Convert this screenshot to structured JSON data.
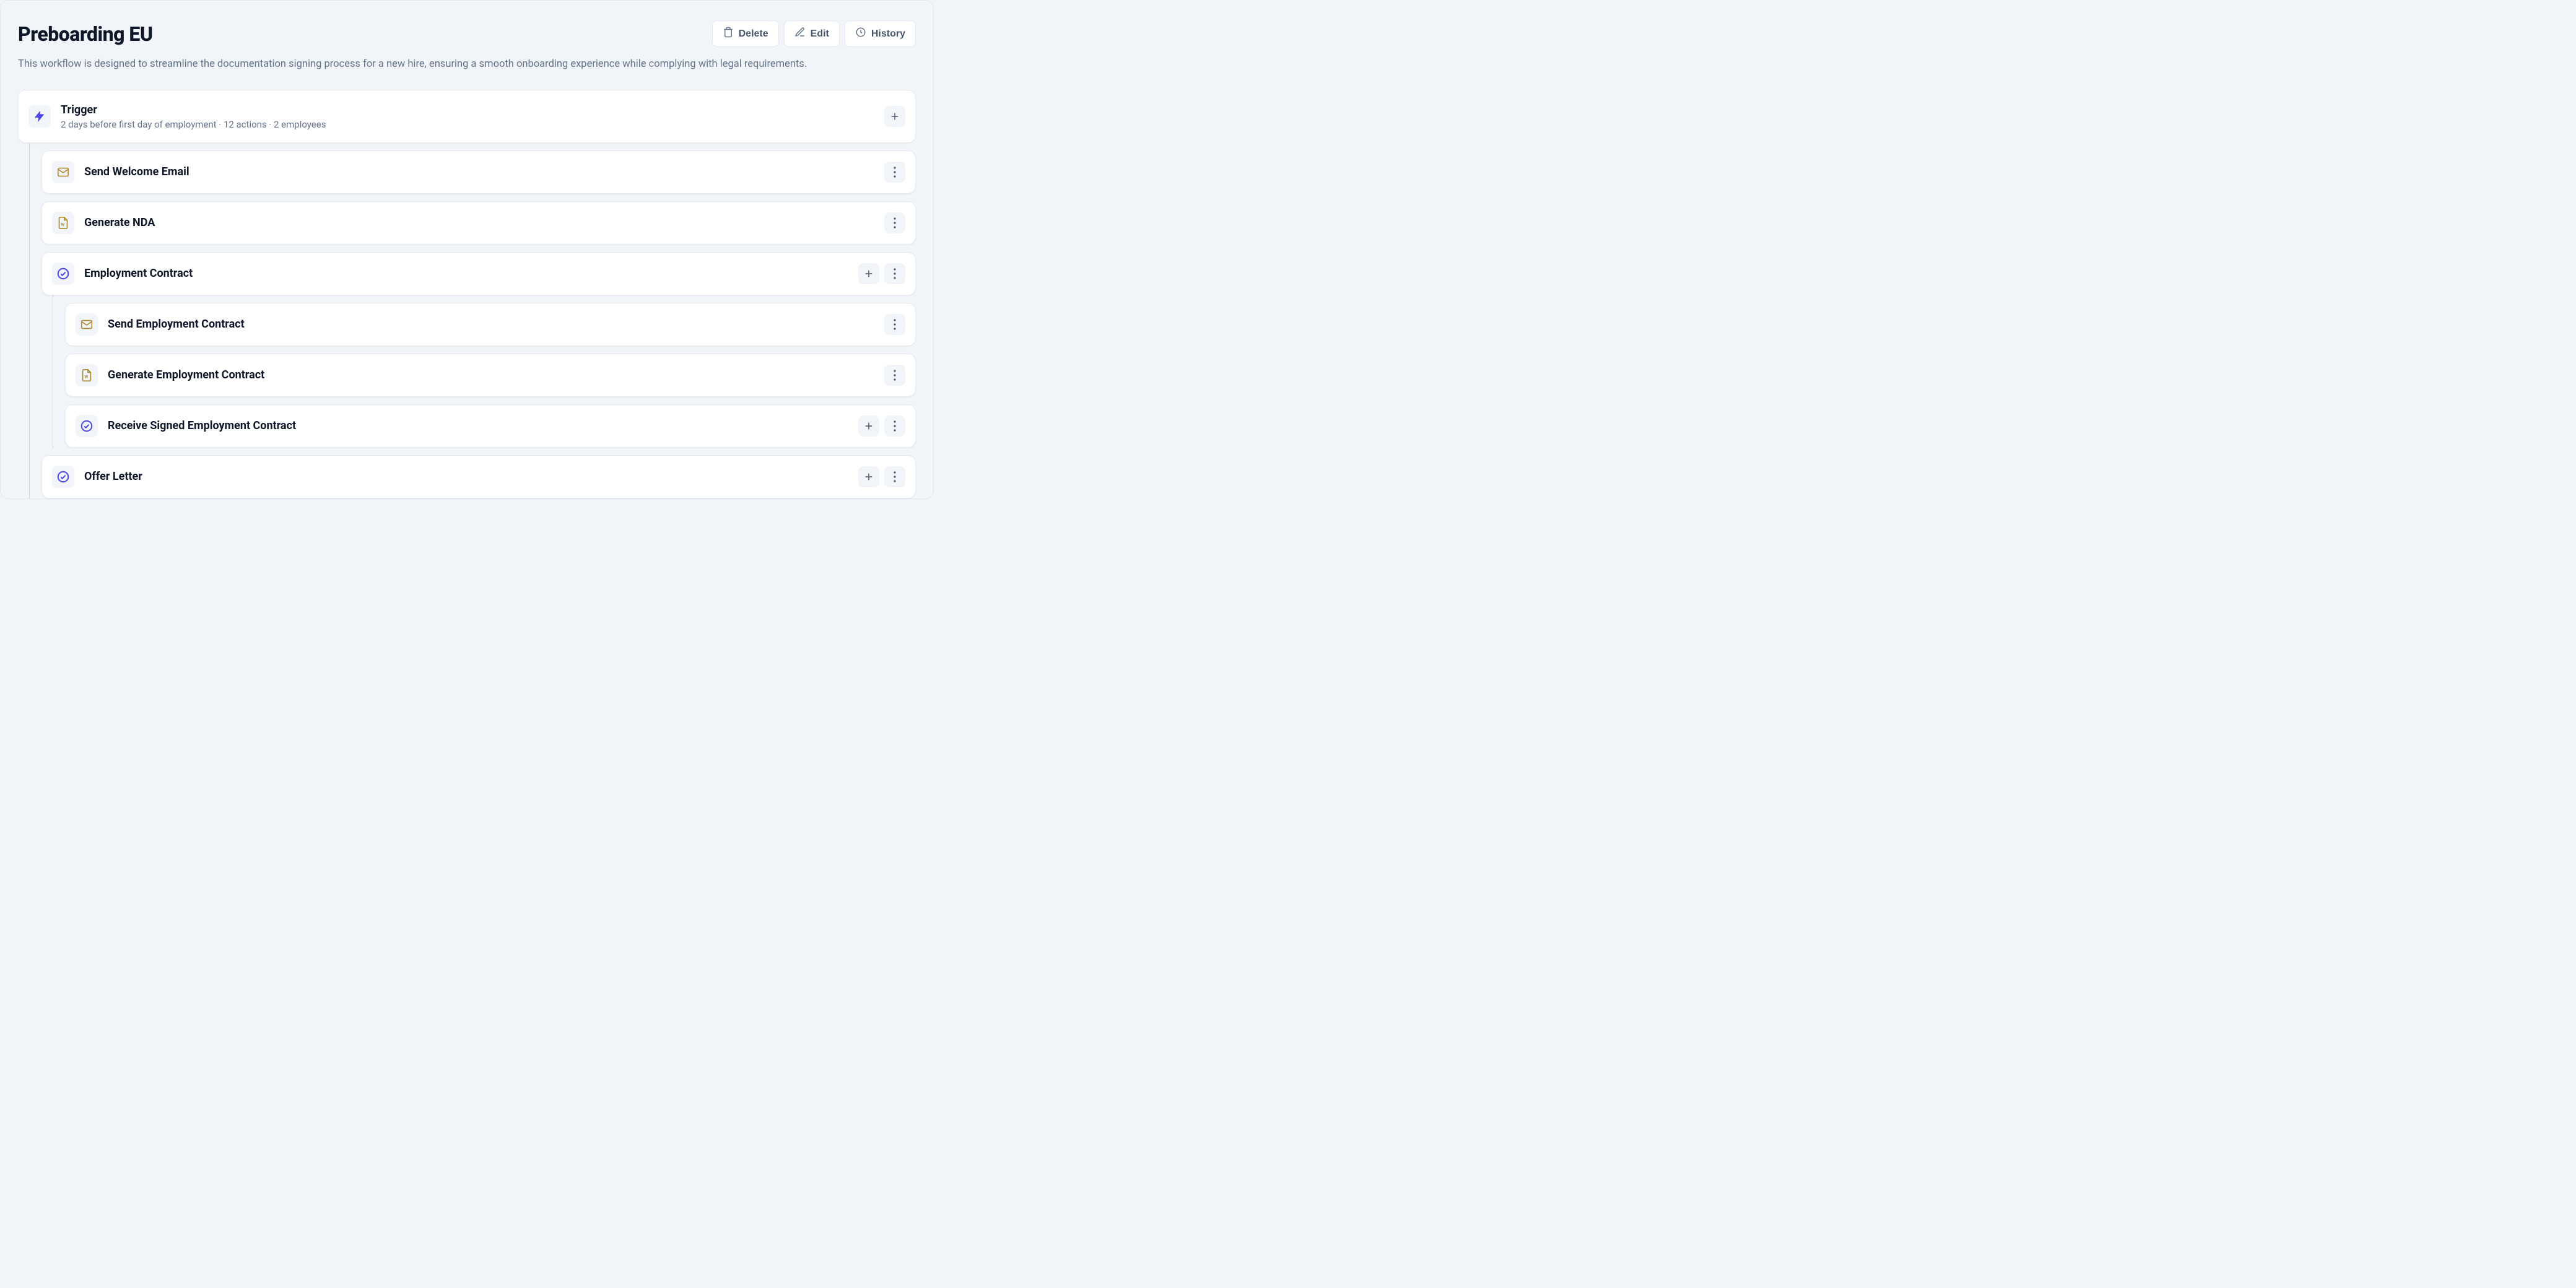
{
  "header": {
    "title": "Preboarding EU",
    "description": "This workflow is designed to streamline the documentation signing process for a new hire, ensuring a smooth onboarding experience while complying with legal requirements.",
    "buttons": {
      "delete": "Delete",
      "edit": "Edit",
      "history": "History"
    }
  },
  "trigger": {
    "title": "Trigger",
    "subtitle": "2 days before first day of employment · 12 actions · 2 employees"
  },
  "nodes": {
    "welcome": "Send Welcome Email",
    "nda": "Generate NDA",
    "contract": "Employment Contract",
    "contract_send": "Send Employment Contract",
    "contract_generate": "Generate Employment Contract",
    "contract_receive": "Receive Signed Employment Contract",
    "offer": "Offer Letter"
  }
}
